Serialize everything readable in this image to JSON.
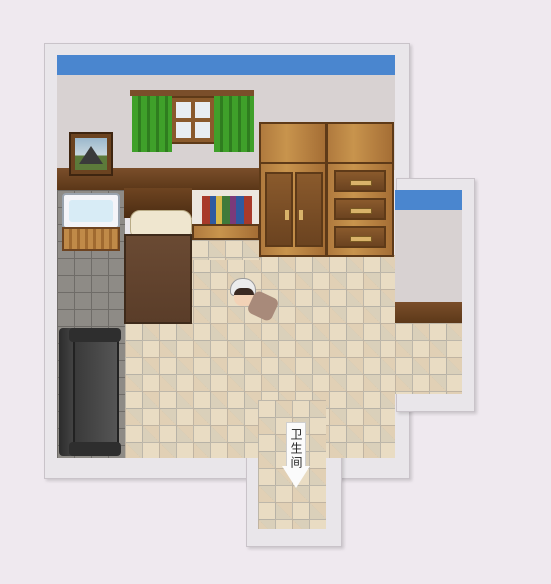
{
  "map": {
    "room_name": "bedroom",
    "exit_sign": {
      "text": "卫生间"
    },
    "objects": [
      "window-with-green-curtains",
      "wall-painting-mountain",
      "wardrobe",
      "dresser",
      "bookshelf-desk",
      "bed",
      "bathtub",
      "sofa",
      "player-character"
    ]
  },
  "colors": {
    "background": "#efe9ef",
    "wall_top_band": "#4a86cf",
    "wall": "#d8d2d2",
    "curtain": "#3fa02a",
    "wood": "#b07a3e"
  }
}
